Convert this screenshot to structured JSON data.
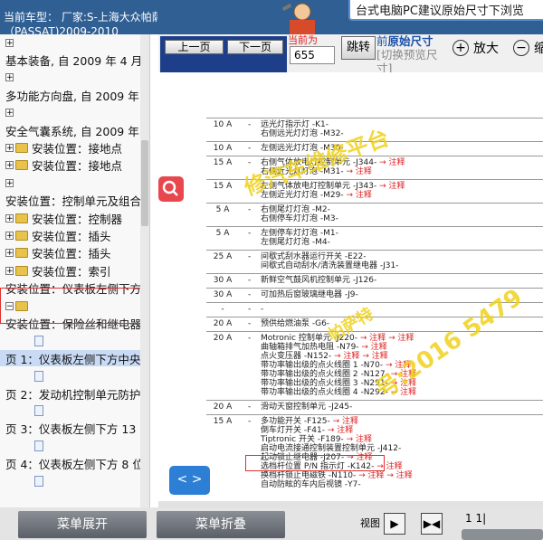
{
  "header": {
    "vehicle_line1": "当前车型：  厂家:S-上海大众帕萨特",
    "vehicle_line2": "（PASSAT)2009-2010",
    "tip": "台式电脑PC建议原始尺寸下浏览"
  },
  "toolbar": {
    "prev_label": "上一页",
    "next_label": "下一页",
    "current_page_label": "当前为",
    "current_page_value": "655",
    "jump_label": "跳转",
    "size_prefix": "前",
    "size_label": "原始尺寸",
    "size_sub": "[切换预览尺寸]",
    "zoom_in": "放大",
    "zoom_out": "缩"
  },
  "tree": [
    {
      "type": "expander",
      "label": ""
    },
    {
      "type": "text",
      "label": "基本装备, 自 2009 年 4 月"
    },
    {
      "type": "expander",
      "label": ""
    },
    {
      "type": "text",
      "label": "多功能方向盘, 自 2009 年"
    },
    {
      "type": "expander",
      "label": ""
    },
    {
      "type": "text",
      "label": "安全气囊系统, 自 2009 年"
    },
    {
      "type": "folder",
      "label": "安装位置：接地点"
    },
    {
      "type": "folder",
      "label": "安装位置：接地点"
    },
    {
      "type": "expander",
      "label": ""
    },
    {
      "type": "text",
      "label": "安装位置：控制单元及组合"
    },
    {
      "type": "folder",
      "label": "安装位置：控制器"
    },
    {
      "type": "folder",
      "label": "安装位置：插头"
    },
    {
      "type": "folder",
      "label": "安装位置：插头"
    },
    {
      "type": "folder",
      "label": "安装位置：索引"
    },
    {
      "type": "text",
      "label": "安装位置：仪表板左侧下方"
    },
    {
      "type": "open-folder",
      "label": ""
    },
    {
      "type": "text",
      "label": "安装位置：保险丝和继电器"
    },
    {
      "type": "page",
      "label": ""
    },
    {
      "type": "text-sel",
      "label": "页 1：仪表板左侧下方中央"
    },
    {
      "type": "page",
      "label": ""
    },
    {
      "type": "text",
      "label": "页 2：发动机控制单元防护"
    },
    {
      "type": "page",
      "label": ""
    },
    {
      "type": "text",
      "label": "页 3：仪表板左侧下方 13"
    },
    {
      "type": "page",
      "label": ""
    },
    {
      "type": "text",
      "label": "页 4：仪表板左侧下方 8 位"
    },
    {
      "type": "page",
      "label": ""
    }
  ],
  "document": {
    "rows": [
      {
        "fuse": "10 A",
        "dash": "-",
        "lines": [
          "远光灯指示灯 -K1-",
          "右侧远光灯灯泡 -M32-"
        ]
      },
      {
        "fuse": "10 A",
        "dash": "-",
        "lines": [
          "左侧远光灯灯泡 -M30-"
        ]
      },
      {
        "fuse": "15 A",
        "dash": "-",
        "lines": [
          "右侧气体放电灯控制单元 -J344- → 注释",
          "右侧近光灯灯泡 -M31- → 注释"
        ]
      },
      {
        "fuse": "15 A",
        "dash": "-",
        "lines": [
          "左侧气体放电灯控制单元 -J343- → 注释",
          "左侧近光灯灯泡 -M29- → 注释"
        ]
      },
      {
        "fuse": "5 A",
        "dash": "-",
        "lines": [
          "右侧尾灯灯泡 -M2-",
          "右侧停车灯灯泡 -M3-"
        ]
      },
      {
        "fuse": "5 A",
        "dash": "-",
        "lines": [
          "左侧停车灯灯泡 -M1-",
          "左侧尾灯灯泡 -M4-"
        ]
      },
      {
        "fuse": "25 A",
        "dash": "-",
        "lines": [
          "间歇式刮水器运行开关 -E22-",
          "间歇式自动刮水/清洗装置继电器 -J31-"
        ]
      },
      {
        "fuse": "30 A",
        "dash": "-",
        "lines": [
          "新鲜空气鼓风机控制单元 -J126-"
        ]
      },
      {
        "fuse": "30 A",
        "dash": "-",
        "lines": [
          "可加热后窗玻璃继电器 -J9-"
        ]
      },
      {
        "fuse": "-",
        "dash": "-",
        "lines": [
          "-"
        ]
      },
      {
        "fuse": "20 A",
        "dash": "-",
        "lines": [
          "预供给燃油泵 -G6-"
        ]
      },
      {
        "fuse": "20 A",
        "dash": "-",
        "lines": [
          "Motronic 控制单元 -J220- → 注释 → 注释",
          "曲轴箱排气加热电阻 -N79- → 注释",
          "点火变压器 -N152- → 注释 → 注释",
          "带功率输出级的点火线圈 1 -N70- → 注释",
          "带功率输出级的点火线圈 2 -N127- → 注释",
          "带功率输出级的点火线圈 3 -N291- → 注释",
          "带功率输出级的点火线圈 4 -N292- → 注释"
        ]
      },
      {
        "fuse": "20 A",
        "dash": "-",
        "lines": [
          "滑动天窗控制单元 -J245-"
        ]
      },
      {
        "fuse": "15 A",
        "dash": "-",
        "lines": [
          "多功能开关 -F125- → 注释",
          "倒车灯开关 -F41- → 注释",
          "Tiptronic 开关 -F189- → 注释",
          "启动电流接通控制装置控制单元 -J412-",
          "起动锁止继电器 -J207- → 注释",
          "选档杆位置 P/N 指示灯 -K142- → 注释",
          "换档杆锁止电磁铁 -N110- → 注释 → 注释",
          "自动防眩的车内后视镜 -Y7-"
        ]
      }
    ],
    "watermarks": [
      "修汽车维修平台",
      "帕萨特",
      "号:2016 5479"
    ]
  },
  "overlay": {
    "search_icon": "search-icon",
    "code_label": "< >"
  },
  "bottom": {
    "expand_label": "菜单展开",
    "collapse_label": "菜单折叠",
    "view_label": "视图",
    "page_label": "1 1|"
  },
  "colors": {
    "header_bg": "#2f5f93",
    "nav_bg": "#1d3f8a",
    "annotation_red": "#e02020",
    "watermark_yellow": "#f0d21c"
  }
}
